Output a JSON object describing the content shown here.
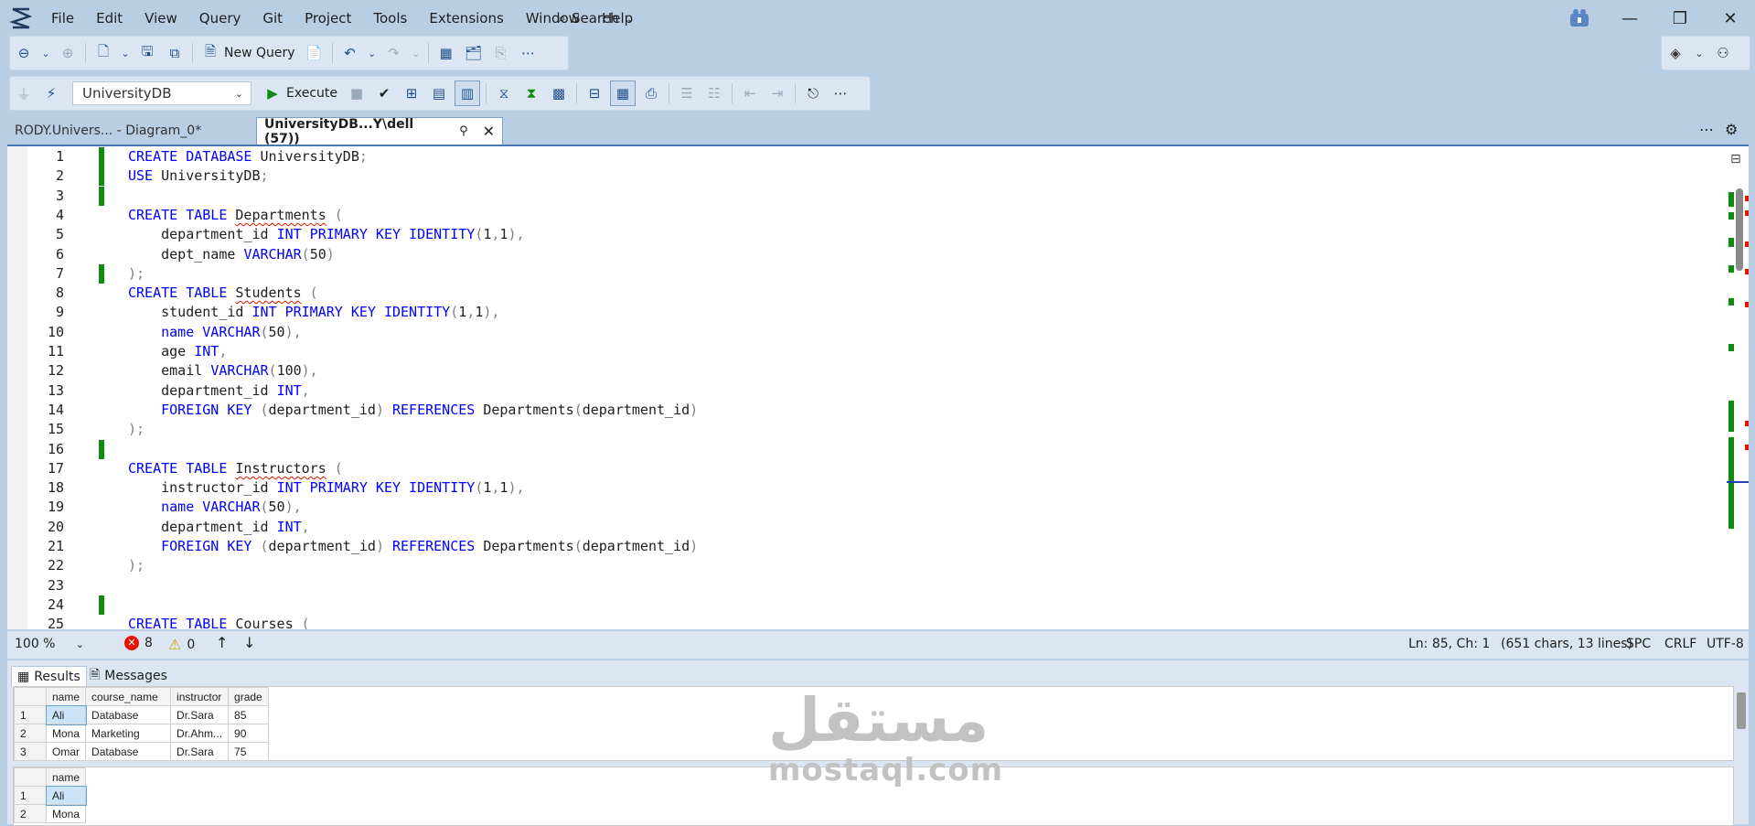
{
  "menu": [
    "File",
    "Edit",
    "View",
    "Query",
    "Git",
    "Project",
    "Tools",
    "Extensions",
    "Window",
    "Help"
  ],
  "search_label": "Search",
  "toolbar2": {
    "new_query_label": "New Query"
  },
  "toolbar3": {
    "database": "UniversityDB",
    "execute_label": "Execute"
  },
  "tabs": [
    {
      "label": "RODY.Univers... - Diagram_0*"
    },
    {
      "label": "UniversityDB...Y\\dell (57))"
    }
  ],
  "code_lines": [
    {
      "n": "1",
      "changed": true,
      "segs": [
        [
          "kw",
          "CREATE DATABASE "
        ],
        [
          "",
          "UniversityDB"
        ],
        [
          "gr",
          ";"
        ]
      ]
    },
    {
      "n": "2",
      "changed": true,
      "segs": [
        [
          "kw",
          "USE "
        ],
        [
          "",
          "UniversityDB"
        ],
        [
          "gr",
          ";"
        ]
      ]
    },
    {
      "n": "3",
      "changed": true,
      "segs": []
    },
    {
      "n": "4",
      "changed": false,
      "segs": [
        [
          "kw",
          "CREATE TABLE "
        ],
        [
          "sq",
          "Departments"
        ],
        [
          "gr",
          " ("
        ]
      ]
    },
    {
      "n": "5",
      "changed": false,
      "segs": [
        [
          "",
          "    department_id "
        ],
        [
          "kw",
          "INT PRIMARY KEY IDENTITY"
        ],
        [
          "gr",
          "("
        ],
        [
          "",
          "1"
        ],
        [
          "gr",
          ","
        ],
        [
          "",
          "1"
        ],
        [
          "gr",
          "),"
        ]
      ]
    },
    {
      "n": "6",
      "changed": false,
      "segs": [
        [
          "",
          "    dept_name "
        ],
        [
          "kw",
          "VARCHAR"
        ],
        [
          "gr",
          "("
        ],
        [
          "",
          "50"
        ],
        [
          "gr",
          ")"
        ]
      ]
    },
    {
      "n": "7",
      "changed": true,
      "segs": [
        [
          "gr",
          ");"
        ]
      ]
    },
    {
      "n": "8",
      "changed": false,
      "segs": [
        [
          "kw",
          "CREATE TABLE "
        ],
        [
          "sq",
          "Students"
        ],
        [
          "gr",
          " ("
        ]
      ]
    },
    {
      "n": "9",
      "changed": false,
      "segs": [
        [
          "",
          "    student_id "
        ],
        [
          "kw",
          "INT PRIMARY KEY IDENTITY"
        ],
        [
          "gr",
          "("
        ],
        [
          "",
          "1"
        ],
        [
          "gr",
          ","
        ],
        [
          "",
          "1"
        ],
        [
          "gr",
          "),"
        ]
      ]
    },
    {
      "n": "10",
      "changed": false,
      "segs": [
        [
          "",
          "    "
        ],
        [
          "kw",
          "name VARCHAR"
        ],
        [
          "gr",
          "("
        ],
        [
          "",
          "50"
        ],
        [
          "gr",
          "),"
        ]
      ]
    },
    {
      "n": "11",
      "changed": false,
      "segs": [
        [
          "",
          "    age "
        ],
        [
          "kw",
          "INT"
        ],
        [
          "gr",
          ","
        ]
      ]
    },
    {
      "n": "12",
      "changed": false,
      "segs": [
        [
          "",
          "    email "
        ],
        [
          "kw",
          "VARCHAR"
        ],
        [
          "gr",
          "("
        ],
        [
          "",
          "100"
        ],
        [
          "gr",
          "),"
        ]
      ]
    },
    {
      "n": "13",
      "changed": false,
      "segs": [
        [
          "",
          "    department_id "
        ],
        [
          "kw",
          "INT"
        ],
        [
          "gr",
          ","
        ]
      ]
    },
    {
      "n": "14",
      "changed": false,
      "segs": [
        [
          "",
          "    "
        ],
        [
          "kw",
          "FOREIGN KEY "
        ],
        [
          "gr",
          "("
        ],
        [
          "",
          "department_id"
        ],
        [
          "gr",
          ") "
        ],
        [
          "kw",
          "REFERENCES "
        ],
        [
          "",
          "Departments"
        ],
        [
          "gr",
          "("
        ],
        [
          "",
          "department_id"
        ],
        [
          "gr",
          ")"
        ]
      ]
    },
    {
      "n": "15",
      "changed": false,
      "segs": [
        [
          "gr",
          ");"
        ]
      ]
    },
    {
      "n": "16",
      "changed": true,
      "segs": []
    },
    {
      "n": "17",
      "changed": false,
      "segs": [
        [
          "kw",
          "CREATE TABLE "
        ],
        [
          "sq",
          "Instructors"
        ],
        [
          "gr",
          " ("
        ]
      ]
    },
    {
      "n": "18",
      "changed": false,
      "segs": [
        [
          "",
          "    instructor_id "
        ],
        [
          "kw",
          "INT PRIMARY KEY IDENTITY"
        ],
        [
          "gr",
          "("
        ],
        [
          "",
          "1"
        ],
        [
          "gr",
          ","
        ],
        [
          "",
          "1"
        ],
        [
          "gr",
          "),"
        ]
      ]
    },
    {
      "n": "19",
      "changed": false,
      "segs": [
        [
          "",
          "    "
        ],
        [
          "kw",
          "name VARCHAR"
        ],
        [
          "gr",
          "("
        ],
        [
          "",
          "50"
        ],
        [
          "gr",
          "),"
        ]
      ]
    },
    {
      "n": "20",
      "changed": false,
      "segs": [
        [
          "",
          "    department_id "
        ],
        [
          "kw",
          "INT"
        ],
        [
          "gr",
          ","
        ]
      ]
    },
    {
      "n": "21",
      "changed": false,
      "segs": [
        [
          "",
          "    "
        ],
        [
          "kw",
          "FOREIGN KEY "
        ],
        [
          "gr",
          "("
        ],
        [
          "",
          "department_id"
        ],
        [
          "gr",
          ") "
        ],
        [
          "kw",
          "REFERENCES "
        ],
        [
          "",
          "Departments"
        ],
        [
          "gr",
          "("
        ],
        [
          "",
          "department_id"
        ],
        [
          "gr",
          ")"
        ]
      ]
    },
    {
      "n": "22",
      "changed": false,
      "segs": [
        [
          "gr",
          ");"
        ]
      ]
    },
    {
      "n": "23",
      "changed": false,
      "segs": []
    },
    {
      "n": "24",
      "changed": true,
      "segs": []
    },
    {
      "n": "25",
      "changed": false,
      "segs": [
        [
          "kw",
          "CREATE TABLE "
        ],
        [
          "sq",
          "Courses"
        ],
        [
          "gr",
          " ("
        ]
      ]
    }
  ],
  "status": {
    "zoom": "100 %",
    "errors": "8",
    "warnings": "0",
    "position": "Ln: 85, Ch: 1",
    "chars": "(651 chars, 13 lines)",
    "spc": "SPC",
    "crlf": "CRLF",
    "encoding": "UTF-8"
  },
  "results_tabs": {
    "results": "Results",
    "messages": "Messages"
  },
  "grid1": {
    "headers": [
      "name",
      "course_name",
      "instructor",
      "grade"
    ],
    "rows": [
      [
        "1",
        "Ali",
        "Database",
        "Dr.Sara",
        "85"
      ],
      [
        "2",
        "Mona",
        "Marketing",
        "Dr.Ahm...",
        "90"
      ],
      [
        "3",
        "Omar",
        "Database",
        "Dr.Sara",
        "75"
      ]
    ]
  },
  "grid2": {
    "headers": [
      "name"
    ],
    "rows": [
      [
        "1",
        "Ali"
      ],
      [
        "2",
        "Mona"
      ]
    ]
  },
  "watermark": {
    "arabic": "مستقل",
    "latin": "mostaql.com"
  }
}
